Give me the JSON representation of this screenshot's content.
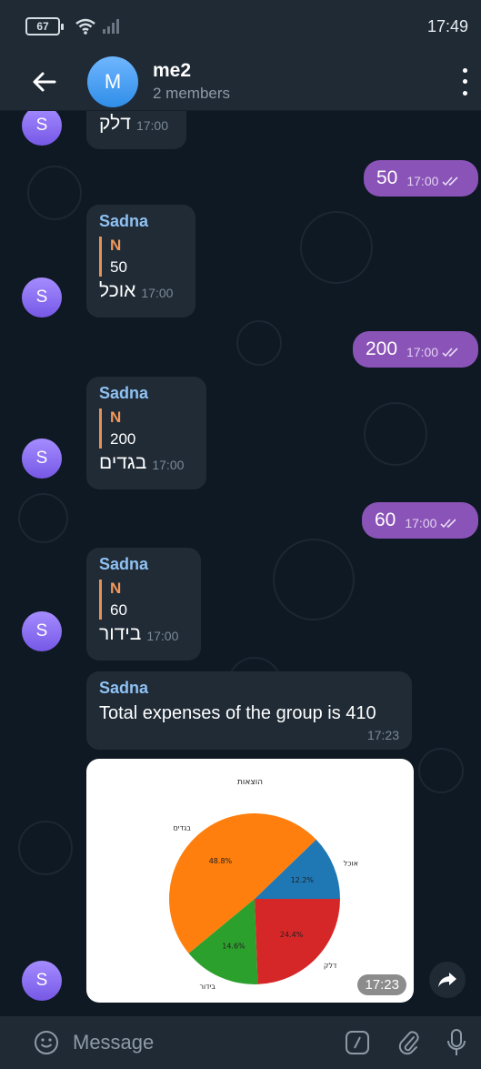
{
  "status_bar": {
    "battery": "67",
    "time": "17:49"
  },
  "header": {
    "avatar_letter": "M",
    "title": "me2",
    "subtitle": "2 members"
  },
  "messages": {
    "m0": {
      "avatar": "S",
      "text": "דלק",
      "time": "17:00"
    },
    "o1": {
      "text": "50",
      "time": "17:00"
    },
    "m1": {
      "avatar": "S",
      "sender": "Sadna",
      "reply_name": "N",
      "reply_text": "50",
      "text": "אוכל",
      "time": "17:00"
    },
    "o2": {
      "text": "200",
      "time": "17:00"
    },
    "m2": {
      "avatar": "S",
      "sender": "Sadna",
      "reply_name": "N",
      "reply_text": "200",
      "text": "בגדים",
      "time": "17:00"
    },
    "o3": {
      "text": "60",
      "time": "17:00"
    },
    "m3": {
      "avatar": "S",
      "sender": "Sadna",
      "reply_name": "N",
      "reply_text": "60",
      "text": "בידור",
      "time": "17:00"
    },
    "m4": {
      "sender": "Sadna",
      "text": "Total expenses of the group is 410",
      "time": "17:23"
    },
    "m5": {
      "avatar": "S",
      "time": "17:23"
    }
  },
  "chart_data": {
    "type": "pie",
    "title": "הוצאות",
    "categories": [
      "אוכל",
      "בגדים",
      "בידור",
      "דלק"
    ],
    "values": [
      12.2,
      48.8,
      14.6,
      24.4
    ],
    "labels": [
      "12.2%",
      "48.8%",
      "14.6%",
      "24.4%"
    ],
    "colors": [
      "#1f77b4",
      "#ff7f0e",
      "#2ca02c",
      "#d62728"
    ]
  },
  "composer": {
    "placeholder": "Message"
  }
}
